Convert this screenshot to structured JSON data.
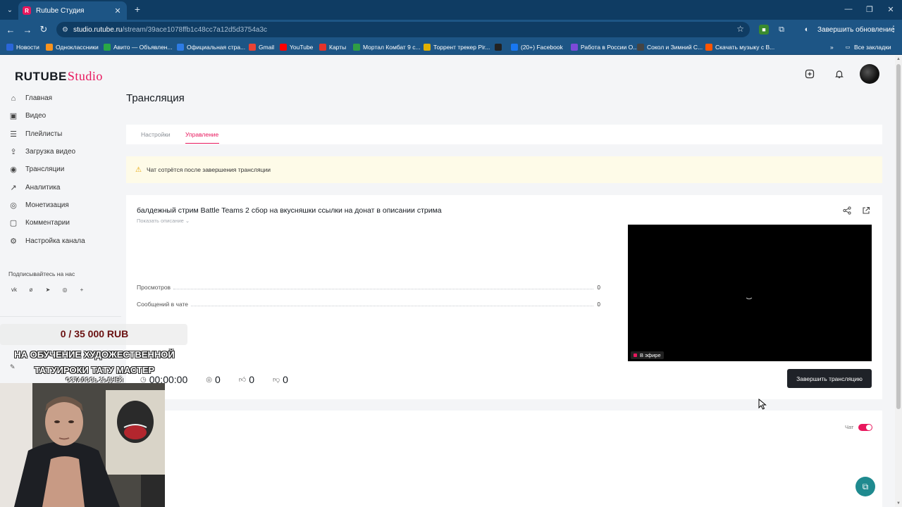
{
  "browser": {
    "tab_title": "Rutube Студия",
    "url_host": "studio.rutube.ru",
    "url_path": "/stream/39ace1078ffb1c48cc7a12d5d3754a3c",
    "update_label": "Завершить обновление",
    "bookmarks": [
      {
        "label": "Новости",
        "color": "#2a66d9"
      },
      {
        "label": "Одноклассники",
        "color": "#f7931e"
      },
      {
        "label": "Авито — Объявлен...",
        "color": "#29a745"
      },
      {
        "label": "Официальная стра...",
        "color": "#2d7be5"
      },
      {
        "label": "Gmail",
        "color": "#ea4335"
      },
      {
        "label": "YouTube",
        "color": "#ff0000"
      },
      {
        "label": "Карты",
        "color": "#e5332a"
      },
      {
        "label": "Мортал Комбат 9 с...",
        "color": "#2f9e44"
      },
      {
        "label": "Торрент трекер Pir...",
        "color": "#e0b000"
      },
      {
        "label": "",
        "color": "#222222"
      },
      {
        "label": "(20+) Facebook",
        "color": "#1877f2"
      },
      {
        "label": "Работа в России О...",
        "color": "#7c4ad9"
      },
      {
        "label": "Сокол и Зимний С...",
        "color": "#444444"
      },
      {
        "label": "Скачать музыку с В...",
        "color": "#ff5500"
      }
    ],
    "all_bookmarks": "Все закладки"
  },
  "header": {
    "logo_main": "RUTUBE",
    "logo_sub": "Studio"
  },
  "sidebar": {
    "items": [
      {
        "label": "Главная",
        "icon": "home-icon"
      },
      {
        "label": "Видео",
        "icon": "video-icon"
      },
      {
        "label": "Плейлисты",
        "icon": "playlist-icon"
      },
      {
        "label": "Загрузка видео",
        "icon": "upload-icon"
      },
      {
        "label": "Трансляции",
        "icon": "broadcast-icon"
      },
      {
        "label": "Аналитика",
        "icon": "analytics-icon"
      },
      {
        "label": "Монетизация",
        "icon": "monetization-icon"
      },
      {
        "label": "Комментарии",
        "icon": "comments-icon"
      },
      {
        "label": "Настройка канала",
        "icon": "settings-icon"
      }
    ],
    "subscribe_label": "Подписывайтесь на нас"
  },
  "main": {
    "page_title": "Трансляция",
    "tabs": [
      {
        "label": "Настройки",
        "active": false
      },
      {
        "label": "Управление",
        "active": true
      }
    ],
    "warning": "Чат сотрётся после завершения трансляции",
    "stream_title": "балдежный стрим Battle Teams 2 сбор на вкусняшки ссылки на донат в описании стрима",
    "show_description": "Показать описание",
    "stats": [
      {
        "label": "Просмотров",
        "value": "0"
      },
      {
        "label": "Сообщений в чате",
        "value": "0"
      }
    ],
    "live_badge": "В эфире",
    "end_button": "Завершить трансляцию",
    "metrics": {
      "duration": "00:00:00",
      "viewers": "0",
      "likes": "0",
      "dislikes": "0"
    },
    "chat_label": "Чат",
    "chat_enabled": true
  },
  "overlay": {
    "donation_amount": "0 / 35 000 RUB",
    "donation_purpose_line1": "НА ОБУЧЕНИЕ ХУДОЖЕСТВЕННОЙ",
    "donation_purpose_line2": "ТАТУИРОКИ ТАТУ МАСТЕР",
    "donation_remaining": "ОСТАЛОСЬ 20 ДНЕЙ"
  },
  "colors": {
    "accent": "#e8175d",
    "browser_dark": "#0f3c63",
    "browser_mid": "#1d5585"
  }
}
